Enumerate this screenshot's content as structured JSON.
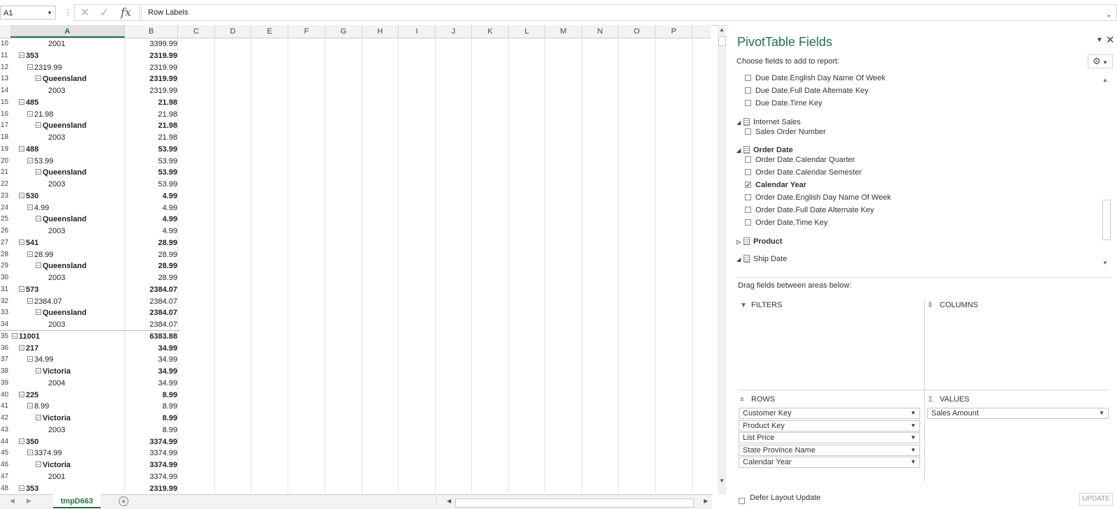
{
  "formula_bar": {
    "name_box": "A1",
    "formula_value": "Row Labels"
  },
  "columns": [
    "A",
    "B",
    "C",
    "D",
    "E",
    "F",
    "G",
    "H",
    "I",
    "J",
    "K",
    "L",
    "M",
    "N",
    "O",
    "P"
  ],
  "rows": [
    {
      "n": "10",
      "a": "2001",
      "b": "3399.99",
      "lvl": 4,
      "bold": false,
      "tog": false
    },
    {
      "n": "11",
      "a": "353",
      "b": "2319.99",
      "lvl": 1,
      "bold": true,
      "tog": true
    },
    {
      "n": "12",
      "a": "2319.99",
      "b": "2319.99",
      "lvl": 2,
      "bold": false,
      "tog": true
    },
    {
      "n": "13",
      "a": "Queensland",
      "b": "2319.99",
      "lvl": 3,
      "bold": true,
      "tog": true
    },
    {
      "n": "14",
      "a": "2003",
      "b": "2319.99",
      "lvl": 4,
      "bold": false,
      "tog": false
    },
    {
      "n": "15",
      "a": "485",
      "b": "21.98",
      "lvl": 1,
      "bold": true,
      "tog": true
    },
    {
      "n": "16",
      "a": "21.98",
      "b": "21.98",
      "lvl": 2,
      "bold": false,
      "tog": true
    },
    {
      "n": "17",
      "a": "Queensland",
      "b": "21.98",
      "lvl": 3,
      "bold": true,
      "tog": true
    },
    {
      "n": "18",
      "a": "2003",
      "b": "21.98",
      "lvl": 4,
      "bold": false,
      "tog": false
    },
    {
      "n": "19",
      "a": "488",
      "b": "53.99",
      "lvl": 1,
      "bold": true,
      "tog": true
    },
    {
      "n": "20",
      "a": "53.99",
      "b": "53.99",
      "lvl": 2,
      "bold": false,
      "tog": true
    },
    {
      "n": "21",
      "a": "Queensland",
      "b": "53.99",
      "lvl": 3,
      "bold": true,
      "tog": true
    },
    {
      "n": "22",
      "a": "2003",
      "b": "53.99",
      "lvl": 4,
      "bold": false,
      "tog": false
    },
    {
      "n": "23",
      "a": "530",
      "b": "4.99",
      "lvl": 1,
      "bold": true,
      "tog": true
    },
    {
      "n": "24",
      "a": "4.99",
      "b": "4.99",
      "lvl": 2,
      "bold": false,
      "tog": true
    },
    {
      "n": "25",
      "a": "Queensland",
      "b": "4.99",
      "lvl": 3,
      "bold": true,
      "tog": true
    },
    {
      "n": "26",
      "a": "2003",
      "b": "4.99",
      "lvl": 4,
      "bold": false,
      "tog": false
    },
    {
      "n": "27",
      "a": "541",
      "b": "28.99",
      "lvl": 1,
      "bold": true,
      "tog": true
    },
    {
      "n": "28",
      "a": "28.99",
      "b": "28.99",
      "lvl": 2,
      "bold": false,
      "tog": true
    },
    {
      "n": "29",
      "a": "Queensland",
      "b": "28.99",
      "lvl": 3,
      "bold": true,
      "tog": true
    },
    {
      "n": "30",
      "a": "2003",
      "b": "28.99",
      "lvl": 4,
      "bold": false,
      "tog": false
    },
    {
      "n": "31",
      "a": "573",
      "b": "2384.07",
      "lvl": 1,
      "bold": true,
      "tog": true
    },
    {
      "n": "32",
      "a": "2384.07",
      "b": "2384.07",
      "lvl": 2,
      "bold": false,
      "tog": true
    },
    {
      "n": "33",
      "a": "Queensland",
      "b": "2384.07",
      "lvl": 3,
      "bold": true,
      "tog": true
    },
    {
      "n": "34",
      "a": "2003",
      "b": "2384.07",
      "lvl": 4,
      "bold": false,
      "tog": false
    },
    {
      "n": "35",
      "a": "11001",
      "b": "6383.88",
      "lvl": 0,
      "bold": true,
      "tog": true
    },
    {
      "n": "36",
      "a": "217",
      "b": "34.99",
      "lvl": 1,
      "bold": true,
      "tog": true
    },
    {
      "n": "37",
      "a": "34.99",
      "b": "34.99",
      "lvl": 2,
      "bold": false,
      "tog": true
    },
    {
      "n": "38",
      "a": "Victoria",
      "b": "34.99",
      "lvl": 3,
      "bold": true,
      "tog": true
    },
    {
      "n": "39",
      "a": "2004",
      "b": "34.99",
      "lvl": 4,
      "bold": false,
      "tog": false
    },
    {
      "n": "40",
      "a": "225",
      "b": "8.99",
      "lvl": 1,
      "bold": true,
      "tog": true
    },
    {
      "n": "41",
      "a": "8.99",
      "b": "8.99",
      "lvl": 2,
      "bold": false,
      "tog": true
    },
    {
      "n": "42",
      "a": "Victoria",
      "b": "8.99",
      "lvl": 3,
      "bold": true,
      "tog": true
    },
    {
      "n": "43",
      "a": "2003",
      "b": "8.99",
      "lvl": 4,
      "bold": false,
      "tog": false
    },
    {
      "n": "44",
      "a": "350",
      "b": "3374.99",
      "lvl": 1,
      "bold": true,
      "tog": true
    },
    {
      "n": "45",
      "a": "3374.99",
      "b": "3374.99",
      "lvl": 2,
      "bold": false,
      "tog": true
    },
    {
      "n": "46",
      "a": "Victoria",
      "b": "3374.99",
      "lvl": 3,
      "bold": true,
      "tog": true
    },
    {
      "n": "47",
      "a": "2001",
      "b": "3374.99",
      "lvl": 4,
      "bold": false,
      "tog": false
    },
    {
      "n": "48",
      "a": "353",
      "b": "2319.99",
      "lvl": 1,
      "bold": true,
      "tog": true
    }
  ],
  "sheet_tab": "tmpD663",
  "pivot": {
    "title": "PivotTable Fields",
    "choose_label": "Choose fields to add to report:",
    "fields": [
      {
        "kind": "field",
        "label": "Due Date.English Day Name Of Week",
        "checked": false,
        "bold": false
      },
      {
        "kind": "field",
        "label": "Due Date.Full Date Alternate Key",
        "checked": false,
        "bold": false
      },
      {
        "kind": "field",
        "label": "Due Date.Time Key",
        "checked": false,
        "bold": false
      },
      {
        "kind": "table",
        "label": "Internet Sales",
        "expanded": true,
        "bold": false
      },
      {
        "kind": "field",
        "label": "Sales Order Number",
        "checked": false,
        "bold": false
      },
      {
        "kind": "table",
        "label": "Order Date",
        "expanded": true,
        "bold": true
      },
      {
        "kind": "field",
        "label": "Order Date.Calendar Quarter",
        "checked": false,
        "bold": false
      },
      {
        "kind": "field",
        "label": "Order Date.Calendar Semester",
        "checked": false,
        "bold": false
      },
      {
        "kind": "field",
        "label": "Calendar Year",
        "checked": true,
        "bold": true
      },
      {
        "kind": "field",
        "label": "Order Date.English Day Name Of Week",
        "checked": false,
        "bold": false
      },
      {
        "kind": "field",
        "label": "Order Date.Full Date Alternate Key",
        "checked": false,
        "bold": false
      },
      {
        "kind": "field",
        "label": "Order Date.Time Key",
        "checked": false,
        "bold": false
      },
      {
        "kind": "table",
        "label": "Product",
        "expanded": false,
        "bold": true
      },
      {
        "kind": "table",
        "label": "Ship Date",
        "expanded": true,
        "bold": false
      }
    ],
    "drag_label": "Drag fields between areas below:",
    "areas": {
      "filters": "FILTERS",
      "columns": "COLUMNS",
      "rows": "ROWS",
      "values": "VALUES"
    },
    "row_fields": [
      "Customer Key",
      "Product Key",
      "List Price",
      "State Province Name",
      "Calendar Year"
    ],
    "value_fields": [
      "Sales Amount"
    ],
    "defer_label": "Defer Layout Update",
    "update_label": "UPDATE"
  }
}
